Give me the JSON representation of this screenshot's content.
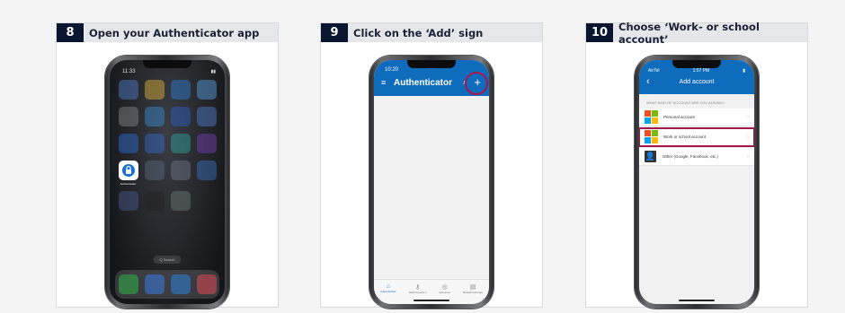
{
  "steps": [
    {
      "number": "8",
      "title": "Open your Authenticator app"
    },
    {
      "number": "9",
      "title": "Click on the ‘Add’ sign"
    },
    {
      "number": "10",
      "title": "Choose ‘Work- or school account’"
    }
  ],
  "phone1": {
    "time": "11:33",
    "active_app": "Authenticator",
    "search": "Q Search"
  },
  "phone2": {
    "time": "10:20",
    "title": "Authenticator",
    "menu_icon": "hamburger-icon",
    "search_icon": "search-icon",
    "add_icon": "plus-icon",
    "tabs": [
      "Authenticator",
      "Wachtwoorden",
      "Adressen",
      "Betaalmethoden"
    ]
  },
  "phone3": {
    "carrier": "AirTel",
    "time": "1:57 PM",
    "title": "Add account",
    "question": "WHAT KIND OF ACCOUNT ARE YOU ADDING?",
    "options": [
      "Personal account",
      "Work or school account",
      "Other (Google, Facebook, etc.)"
    ]
  },
  "colors": {
    "step_badge": "#0a1530",
    "highlight": "#a3174e",
    "brand_blue": "#0f6cbd"
  }
}
